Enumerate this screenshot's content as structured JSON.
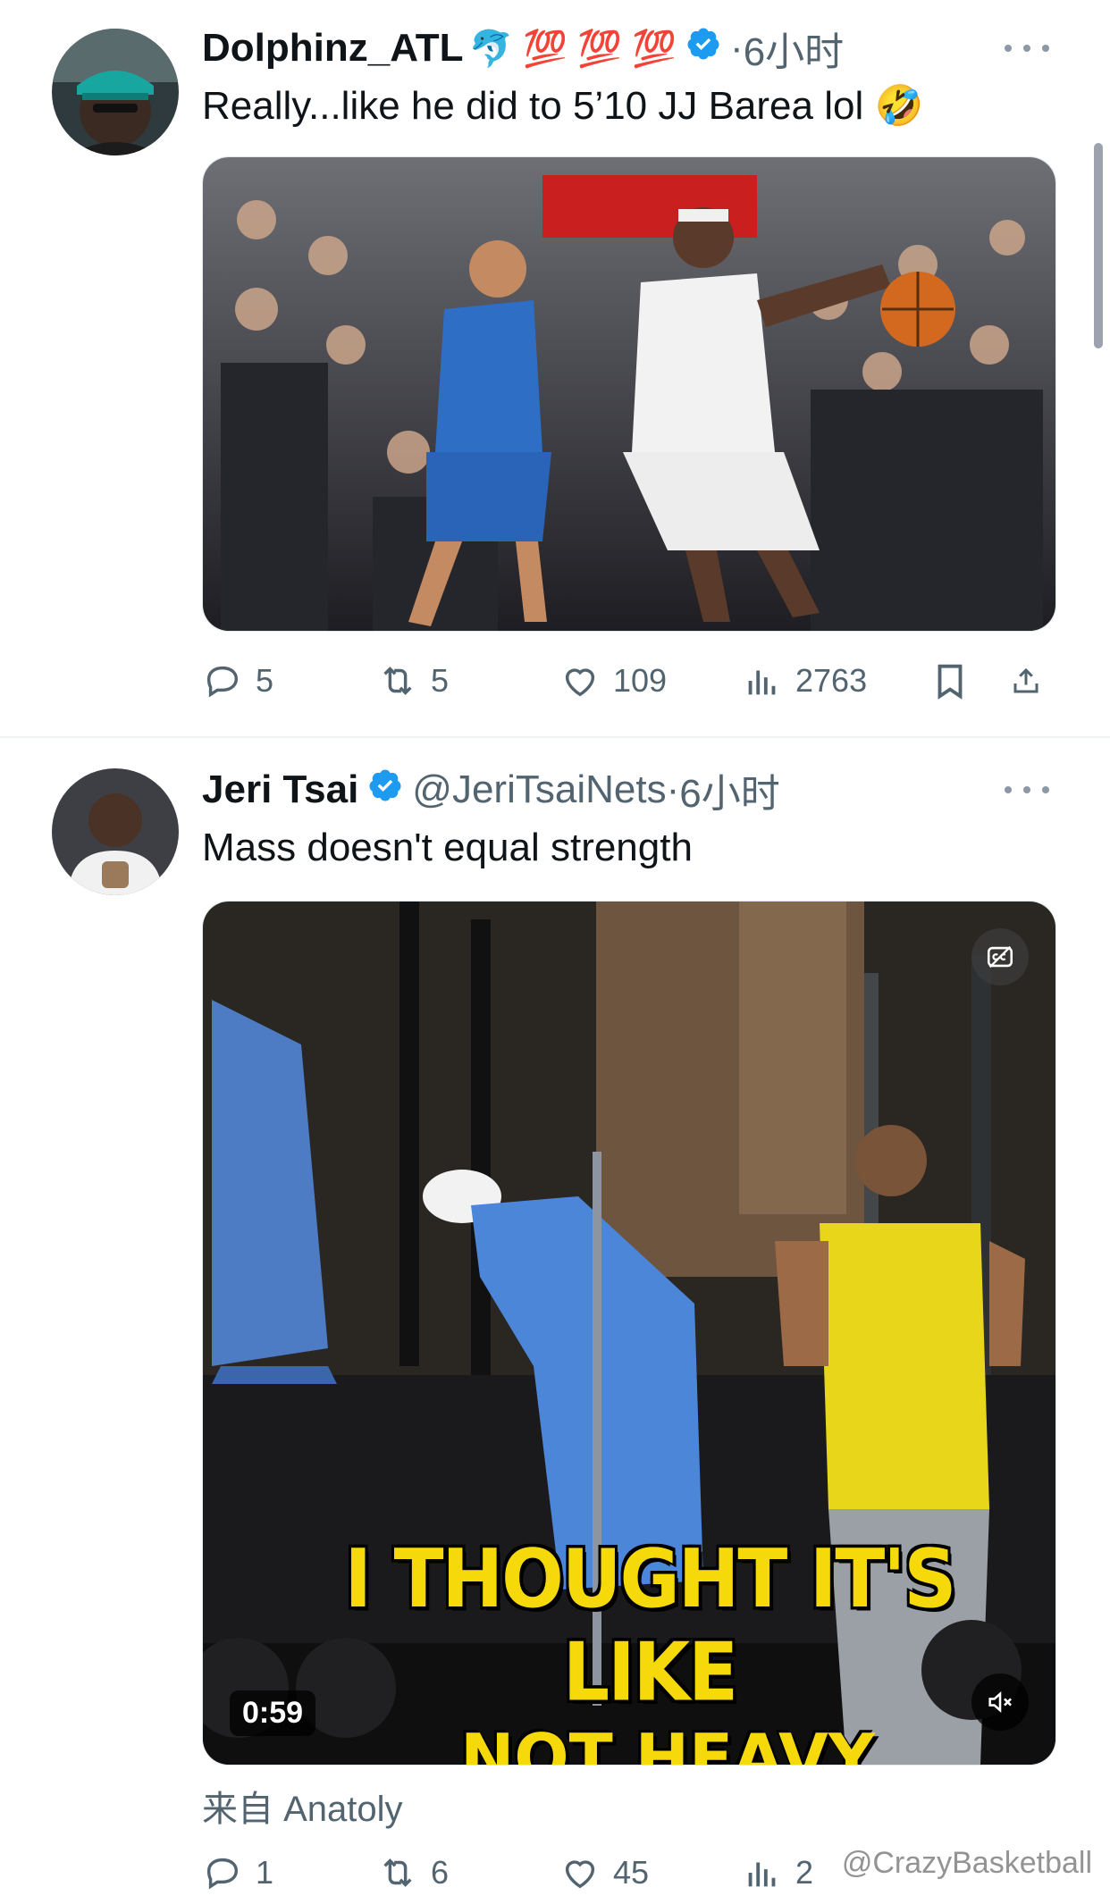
{
  "tweets": [
    {
      "name": "Dolphinz_ATL",
      "name_emojis": "🐬 💯 💯 💯",
      "dot": "·",
      "time": "6小时",
      "text": "Really...like he did to 5’10 JJ Barea lol 🤣",
      "actions": {
        "replies": "5",
        "reposts": "5",
        "likes": "109",
        "views": "2763"
      }
    },
    {
      "name": "Jeri Tsai",
      "handle": "@JeriTsaiNets",
      "dot": "·",
      "time": "6小时",
      "text": "Mass doesn't equal strength",
      "video": {
        "duration": "0:59",
        "caption_line1": "I THOUGHT IT'S LIKE",
        "caption_line2": "NOT HEAVY"
      },
      "source": "来自 Anatoly",
      "actions": {
        "replies": "1",
        "reposts": "6",
        "likes": "45",
        "views": "2"
      }
    }
  ],
  "watermark": "@CrazyBasketball",
  "colors": {
    "verified": "#1d9bf0",
    "text_secondary": "#536471",
    "caption": "#f5d90a"
  }
}
